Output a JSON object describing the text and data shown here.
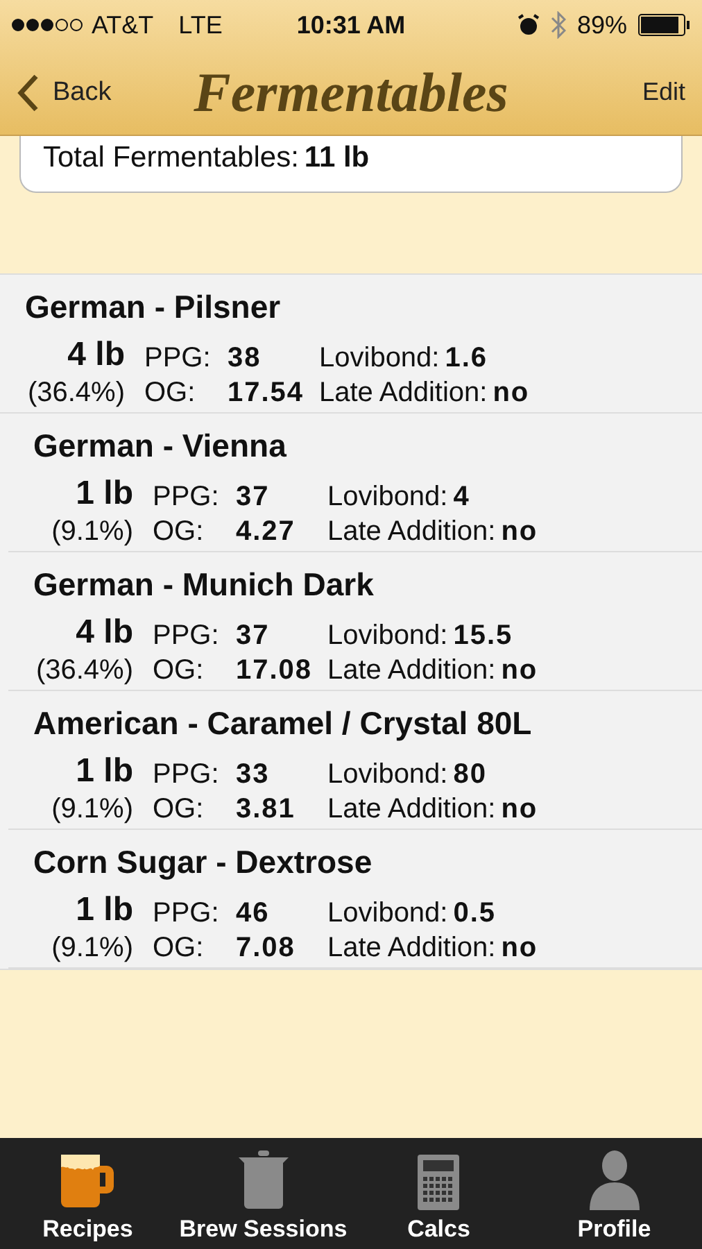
{
  "status_bar": {
    "carrier": "AT&T",
    "network": "LTE",
    "time": "10:31 AM",
    "battery": "89%"
  },
  "nav": {
    "back": "Back",
    "title": "Fermentables",
    "action": "Edit"
  },
  "total": {
    "label": "Total Fermentables:",
    "value": "11 lb"
  },
  "fermentables": [
    {
      "name": "German - Pilsner",
      "weight": "4 lb",
      "percent": "(36.4%)",
      "ppg_label": "PPG:",
      "ppg": "38",
      "og_label": "OG:",
      "og": "17.54",
      "lovibond_label": "Lovibond:",
      "lovibond": "1.6",
      "late_label": "Late Addition:",
      "late": "no"
    },
    {
      "name": "German - Vienna",
      "weight": "1 lb",
      "percent": "(9.1%)",
      "ppg_label": "PPG:",
      "ppg": "37",
      "og_label": "OG:",
      "og": "4.27",
      "lovibond_label": "Lovibond:",
      "lovibond": "4",
      "late_label": "Late Addition:",
      "late": "no"
    },
    {
      "name": "German - Munich Dark",
      "weight": "4 lb",
      "percent": "(36.4%)",
      "ppg_label": "PPG:",
      "ppg": "37",
      "og_label": "OG:",
      "og": "17.08",
      "lovibond_label": "Lovibond:",
      "lovibond": "15.5",
      "late_label": "Late Addition:",
      "late": "no"
    },
    {
      "name": "American - Caramel / Crystal 80L",
      "weight": "1 lb",
      "percent": "(9.1%)",
      "ppg_label": "PPG:",
      "ppg": "33",
      "og_label": "OG:",
      "og": "3.81",
      "lovibond_label": "Lovibond:",
      "lovibond": "80",
      "late_label": "Late Addition:",
      "late": "no"
    },
    {
      "name": "Corn Sugar - Dextrose",
      "weight": "1 lb",
      "percent": "(9.1%)",
      "ppg_label": "PPG:",
      "ppg": "46",
      "og_label": "OG:",
      "og": "7.08",
      "lovibond_label": "Lovibond:",
      "lovibond": "0.5",
      "late_label": "Late Addition:",
      "late": "no"
    }
  ],
  "tabs": [
    {
      "label": "Recipes",
      "kind": "mug",
      "selected": true
    },
    {
      "label": "Brew Sessions",
      "kind": "kettle",
      "selected": false
    },
    {
      "label": "Calcs",
      "kind": "calculator",
      "selected": false
    },
    {
      "label": "Profile",
      "kind": "person",
      "selected": false
    }
  ]
}
